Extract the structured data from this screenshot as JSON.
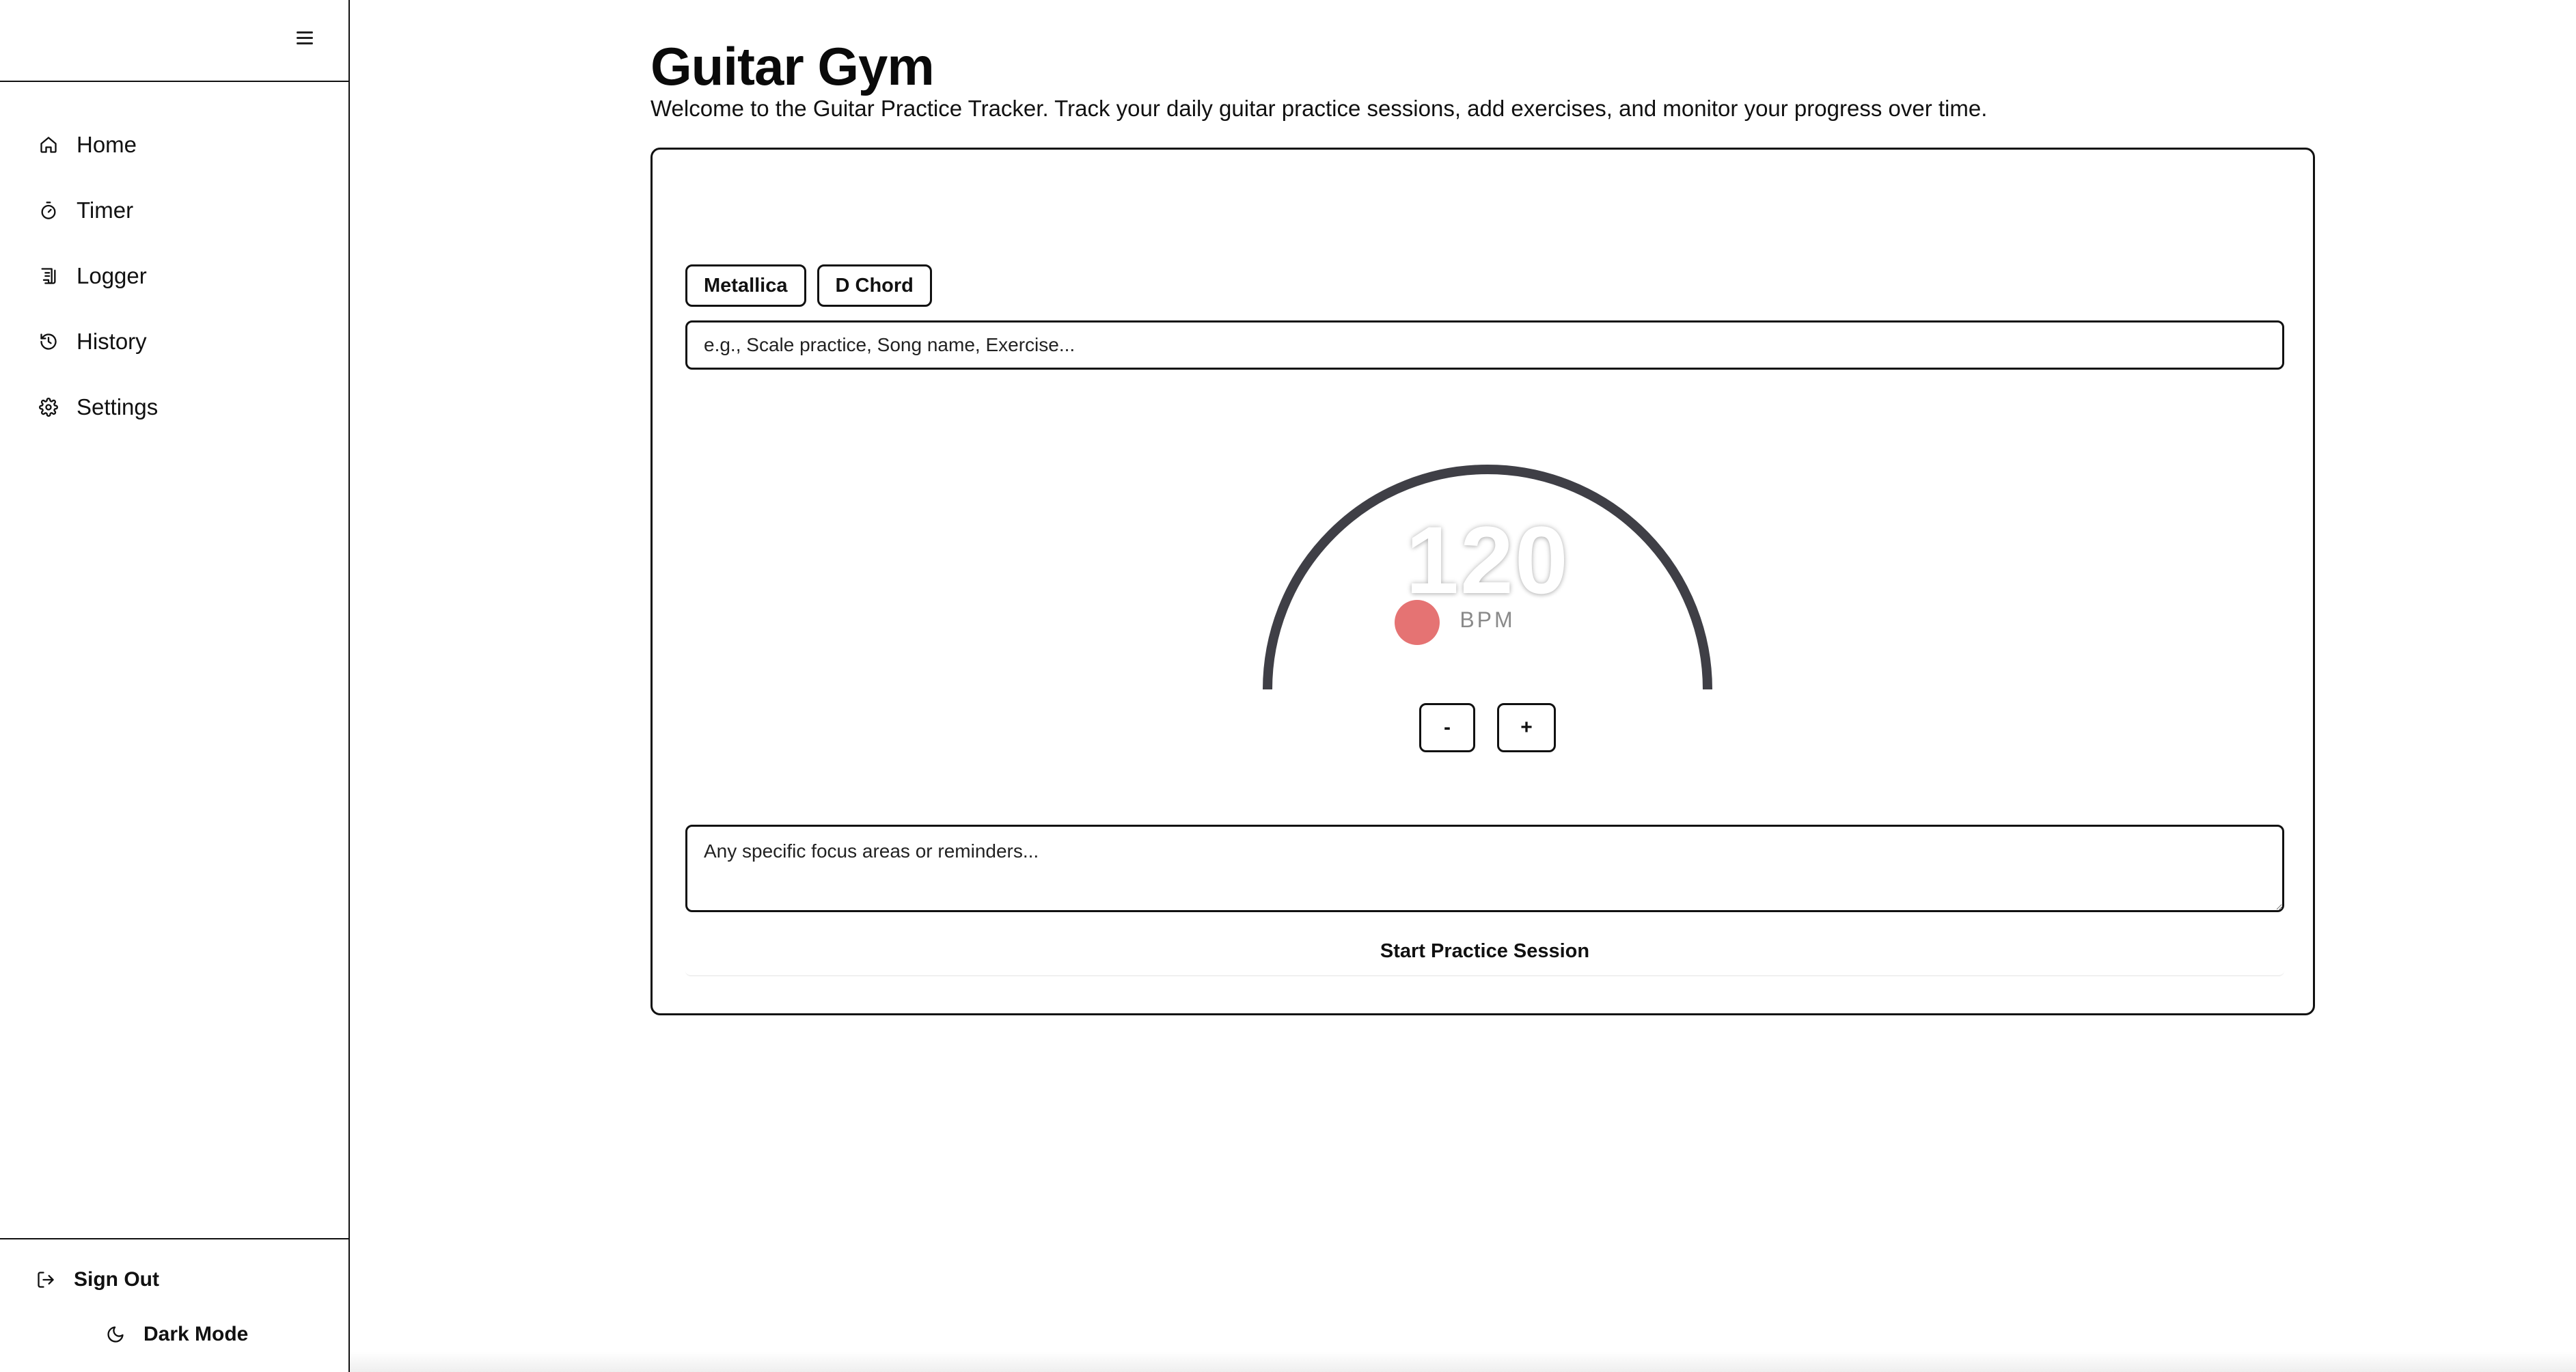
{
  "sidebar": {
    "menu_icon": "hamburger-icon",
    "items": [
      {
        "label": "Home",
        "icon": "home-icon"
      },
      {
        "label": "Timer",
        "icon": "stopwatch-icon"
      },
      {
        "label": "Logger",
        "icon": "scroll-icon"
      },
      {
        "label": "History",
        "icon": "history-icon"
      },
      {
        "label": "Settings",
        "icon": "gear-icon"
      }
    ],
    "footer": {
      "sign_out": "Sign Out",
      "dark_mode": "Dark Mode"
    }
  },
  "main": {
    "title": "Guitar Gym",
    "description": "Welcome to the Guitar Practice Tracker. Track your daily guitar practice sessions, add exercises, and monitor your progress over time.",
    "tags": [
      "Metallica",
      "D Chord"
    ],
    "exercise_placeholder": "e.g., Scale practice, Song name, Exercise...",
    "tempo": {
      "value": "120",
      "unit": "BPM",
      "decrement_label": "-",
      "increment_label": "+",
      "knob_color": "#e57373",
      "arc_color": "#3f3f46"
    },
    "notes_placeholder": "Any specific focus areas or reminders...",
    "start_button": "Start Practice Session"
  }
}
